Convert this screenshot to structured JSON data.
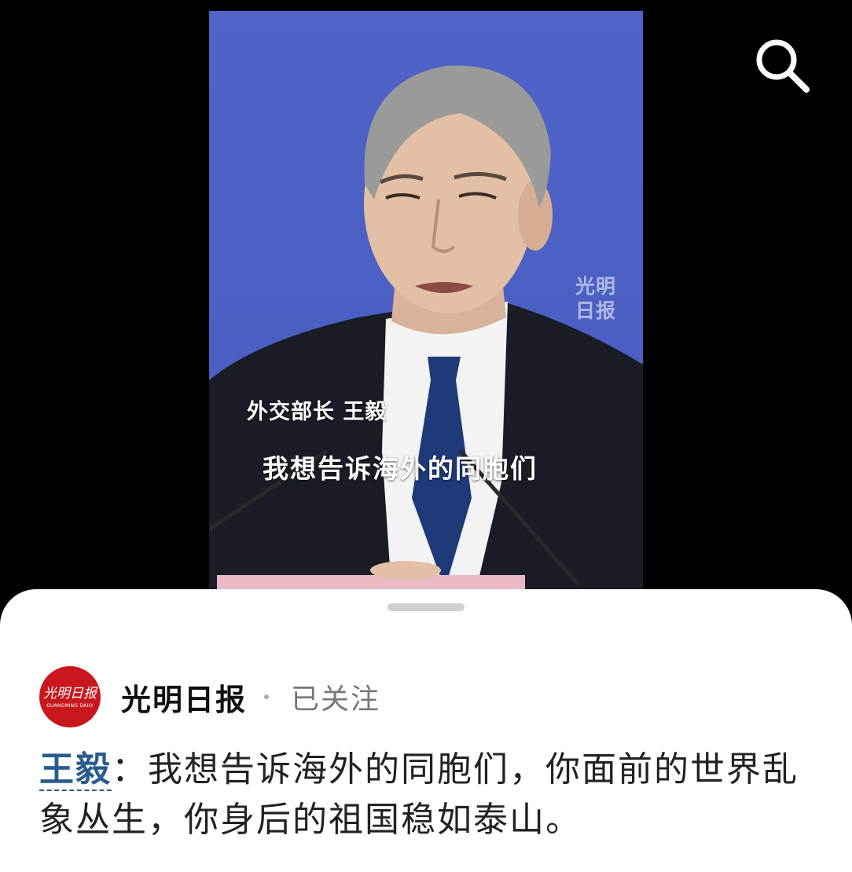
{
  "video": {
    "watermark_line1": "光明",
    "watermark_line2": "日报",
    "caption_name": "外交部长 王毅",
    "caption_text": "我想告诉海外的同胞们"
  },
  "toolbar": {
    "search_icon": "search-icon"
  },
  "post": {
    "author": {
      "avatar_text_cn": "光明日报",
      "avatar_text_en": "GUANGMING DAILY",
      "name": "光明日报",
      "follow_status": "已关注"
    },
    "mention": "王毅",
    "separator": "：",
    "text": "我想告诉海外的同胞们，你面前的世界乱象丛生，你身后的祖国稳如泰山。"
  },
  "colors": {
    "video_background": "#4c5fc2",
    "mention": "#2a5b8f",
    "avatar": "#c8171e"
  }
}
